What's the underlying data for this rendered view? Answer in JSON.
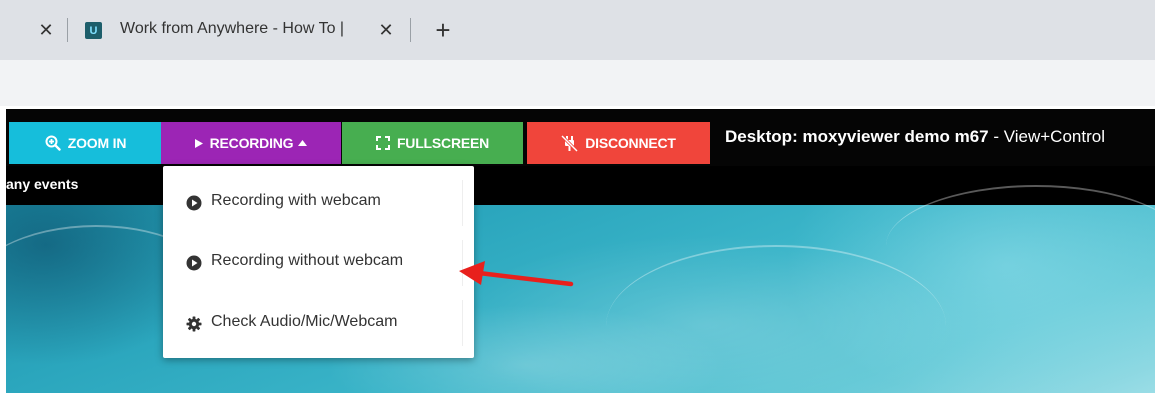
{
  "browser": {
    "prev_tab_close": "✕",
    "active_tab": {
      "favicon_letter": "U",
      "title": "Work from Anywhere - How To | ",
      "close": "✕"
    },
    "new_tab": "+"
  },
  "toolbar": {
    "zoom_in_label": "ZOOM IN",
    "recording_label": "RECORDING",
    "fullscreen_label": "FULLSCREEN",
    "disconnect_label": "DISCONNECT",
    "desktop_title": "Desktop: moxyviewer demo m67",
    "desktop_mode": " - View+Control"
  },
  "events_bar": {
    "text": "any events"
  },
  "recording_menu": {
    "items": [
      {
        "label": "Recording with webcam",
        "icon": "play-circle-icon"
      },
      {
        "label": "Recording without webcam",
        "icon": "play-circle-icon"
      },
      {
        "label": "Check Audio/Mic/Webcam",
        "icon": "gear-icon"
      }
    ]
  },
  "colors": {
    "zoom": "#16bedb",
    "recording": "#9c25b5",
    "fullscreen": "#47ae50",
    "disconnect": "#f0453b",
    "annotation_arrow": "#e8201c"
  }
}
